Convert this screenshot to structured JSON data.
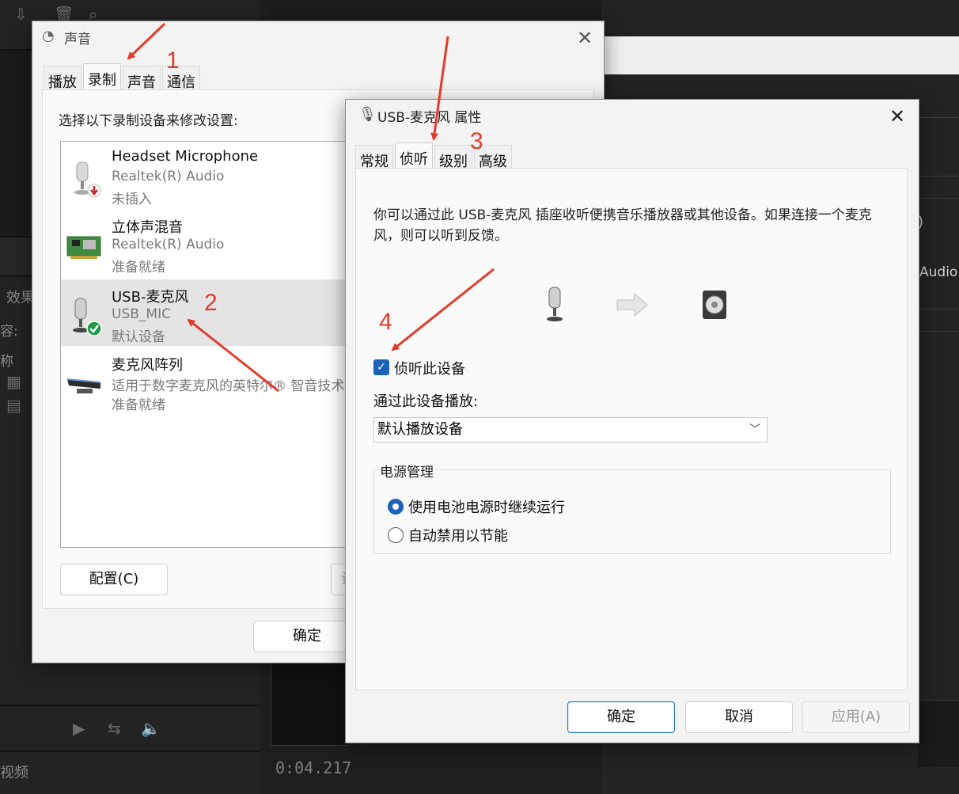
{
  "background": {
    "left_labels": [
      "效果",
      "容:",
      "称",
      "视频"
    ],
    "timecode": "0:04.217",
    "right_labels": [
      ")",
      "Audio)"
    ]
  },
  "sound_window": {
    "title": "声音",
    "tabs": [
      "播放",
      "录制",
      "声音",
      "通信"
    ],
    "instruction": "选择以下录制设备来修改设置:",
    "devices": [
      {
        "name": "Headset Microphone",
        "driver": "Realtek(R) Audio",
        "status": "未插入"
      },
      {
        "name": "立体声混音",
        "driver": "Realtek(R) Audio",
        "status": "准备就绪"
      },
      {
        "name": "USB-麦克风",
        "driver": "USB_MIC",
        "status": "默认设备"
      },
      {
        "name": "麦克风阵列",
        "driver": "适用于数字麦克风的英特尔® 智音技术",
        "status": "准备就绪"
      }
    ],
    "configure_button": "配置(C)",
    "settings_button_partial": "设",
    "ok_button": "确定"
  },
  "usb_window": {
    "title": "USB-麦克风 属性",
    "tabs": [
      "常规",
      "侦听",
      "级别",
      "高级"
    ],
    "description": "你可以通过此 USB-麦克风 插座收听便携音乐播放器或其他设备。如果连接一个麦克风，则可以听到反馈。",
    "listen_checkbox_label": "侦听此设备",
    "playback_label": "通过此设备播放:",
    "playback_selected": "默认播放设备",
    "power_group_title": "电源管理",
    "radio_continue": "使用电池电源时继续运行",
    "radio_disable": "自动禁用以节能",
    "ok_button": "确定",
    "cancel_button": "取消",
    "apply_button": "应用(A)"
  },
  "annotations": [
    "1",
    "2",
    "3",
    "4"
  ],
  "colors": {
    "accent": "#1b63b8",
    "annotation": "#e33a2a",
    "selected_row": "#e4e4e4"
  }
}
